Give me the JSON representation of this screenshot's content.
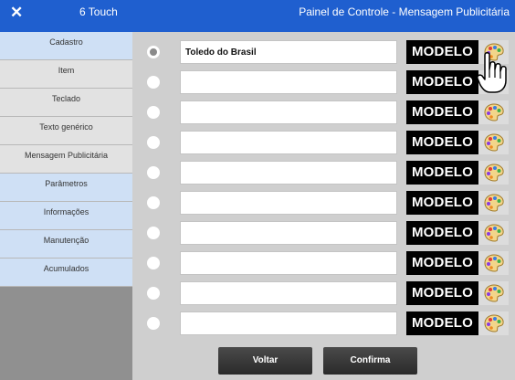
{
  "titlebar": {
    "close_glyph": "✕",
    "app_name": "6 Touch",
    "title": "Painel de Controle - Mensagem Publicitária",
    "background": "#1f5fcf"
  },
  "sidebar": {
    "items": [
      {
        "label": "Cadastro",
        "style": "blue"
      },
      {
        "label": "Item",
        "style": "grey"
      },
      {
        "label": "Teclado",
        "style": "grey"
      },
      {
        "label": "Texto genérico",
        "style": "grey"
      },
      {
        "label": "Mensagem Publicitária",
        "style": "grey"
      },
      {
        "label": "Parâmetros",
        "style": "blue"
      },
      {
        "label": "Informações",
        "style": "blue"
      },
      {
        "label": "Manutenção",
        "style": "blue"
      },
      {
        "label": "Acumulados",
        "style": "blue"
      }
    ]
  },
  "messages": {
    "rows": [
      {
        "text": "Toledo do Brasil",
        "selected": true,
        "button_label": "MODELO",
        "icon": "palette-icon"
      },
      {
        "text": "",
        "selected": false,
        "button_label": "MODELO",
        "icon": "palette-icon"
      },
      {
        "text": "",
        "selected": false,
        "button_label": "MODELO",
        "icon": "palette-icon"
      },
      {
        "text": "",
        "selected": false,
        "button_label": "MODELO",
        "icon": "palette-icon"
      },
      {
        "text": "",
        "selected": false,
        "button_label": "MODELO",
        "icon": "palette-icon"
      },
      {
        "text": "",
        "selected": false,
        "button_label": "MODELO",
        "icon": "palette-icon"
      },
      {
        "text": "",
        "selected": false,
        "button_label": "MODELO",
        "icon": "palette-icon"
      },
      {
        "text": "",
        "selected": false,
        "button_label": "MODELO",
        "icon": "palette-icon"
      },
      {
        "text": "",
        "selected": false,
        "button_label": "MODELO",
        "icon": "palette-icon"
      },
      {
        "text": "",
        "selected": false,
        "button_label": "MODELO",
        "icon": "palette-icon"
      }
    ]
  },
  "actions": {
    "back_label": "Voltar",
    "confirm_label": "Confirma"
  },
  "cursor": {
    "icon": "hand-pointer-icon"
  }
}
